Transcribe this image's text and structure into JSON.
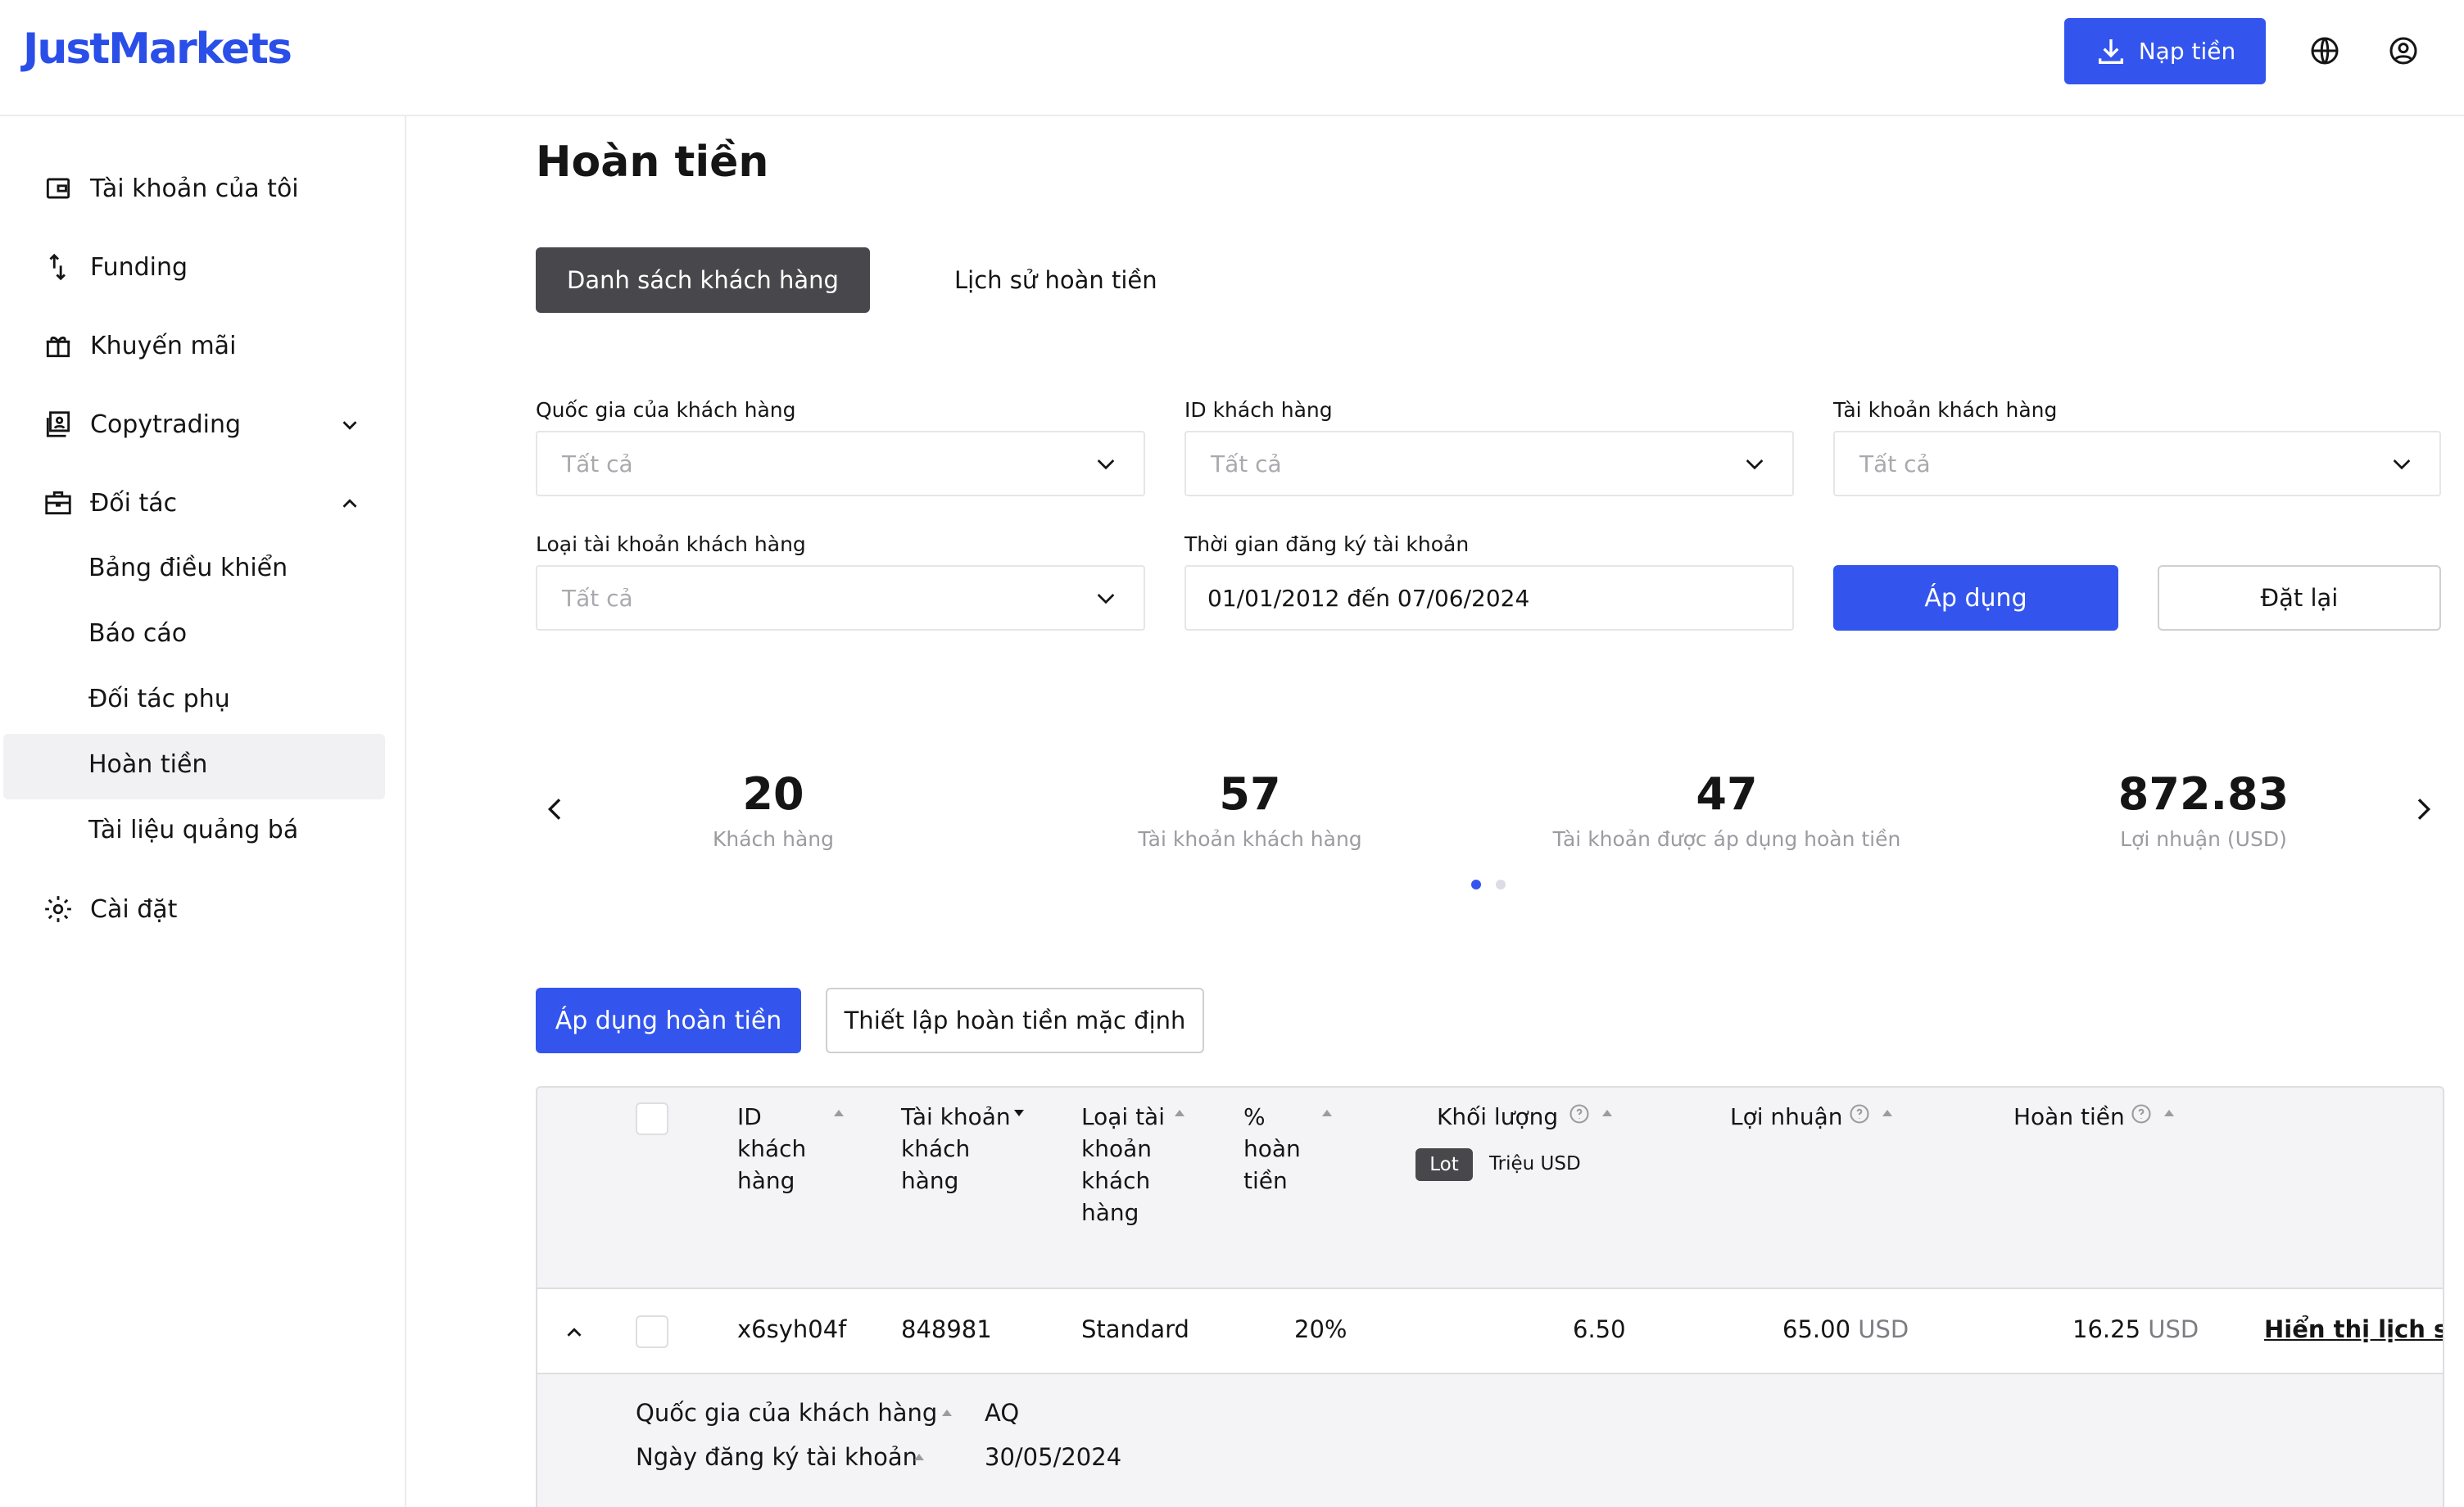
{
  "header": {
    "logo": "JustMarkets",
    "deposit_label": "Nạp tiền"
  },
  "sidebar": {
    "items": [
      {
        "label": "Tài khoản của tôi"
      },
      {
        "label": "Funding"
      },
      {
        "label": "Khuyến mãi"
      },
      {
        "label": "Copytrading"
      },
      {
        "label": "Đối tác"
      },
      {
        "label": "Cài đặt"
      }
    ],
    "sub_items": [
      {
        "label": "Bảng điều khiển"
      },
      {
        "label": "Báo cáo"
      },
      {
        "label": "Đối tác phụ"
      },
      {
        "label": "Hoàn tiền"
      },
      {
        "label": "Tài liệu quảng bá"
      }
    ]
  },
  "page": {
    "title": "Hoàn tiền"
  },
  "tabs": [
    "Danh sách khách hàng",
    "Lịch sử hoàn tiền"
  ],
  "filters": {
    "country": {
      "label": "Quốc gia của khách hàng",
      "value": "Tất cả"
    },
    "client_id": {
      "label": "ID khách hàng",
      "value": "Tất cả"
    },
    "client_account": {
      "label": "Tài khoản khách hàng",
      "value": "Tất cả"
    },
    "account_type": {
      "label": "Loại tài khoản khách hàng",
      "value": "Tất cả"
    },
    "reg_period": {
      "label": "Thời gian đăng ký tài khoản",
      "value": "01/01/2012 đến 07/06/2024"
    },
    "apply_label": "Áp dụng",
    "reset_label": "Đặt lại"
  },
  "stats": [
    {
      "value": "20",
      "label": "Khách hàng"
    },
    {
      "value": "57",
      "label": "Tài khoản khách hàng"
    },
    {
      "value": "47",
      "label": "Tài khoản được áp dụng hoàn tiền"
    },
    {
      "value": "872.83",
      "label": "Lợi nhuận (USD)"
    }
  ],
  "actions": {
    "apply_rebate": "Áp dụng hoàn tiền",
    "default_rebate": "Thiết lập hoàn tiền mặc định"
  },
  "table": {
    "headers": {
      "client_id": "ID khách hàng",
      "client_account": "Tài khoản khách hàng",
      "account_type": "Loại tài khoản khách hàng",
      "rebate_pct": "% hoàn tiền",
      "volume": "Khối lượng",
      "profit": "Lợi nhuận",
      "rebate": "Hoàn tiền"
    },
    "volume_toggle": {
      "lot": "Lot",
      "musd": "Triệu USD"
    },
    "rows": [
      {
        "client_id": "x6syh04f",
        "account": "848981",
        "type": "Standard",
        "pct": "20%",
        "volume": "6.50",
        "profit": "65.00",
        "profit_unit": "USD",
        "rebate": "16.25",
        "rebate_unit": "USD",
        "history_link": "Hiển thị lịch sử h"
      }
    ],
    "detail": {
      "country_label": "Quốc gia của khách hàng",
      "country_value": "AQ",
      "reg_label": "Ngày đăng ký tài khoản",
      "reg_value": "30/05/2024"
    }
  }
}
